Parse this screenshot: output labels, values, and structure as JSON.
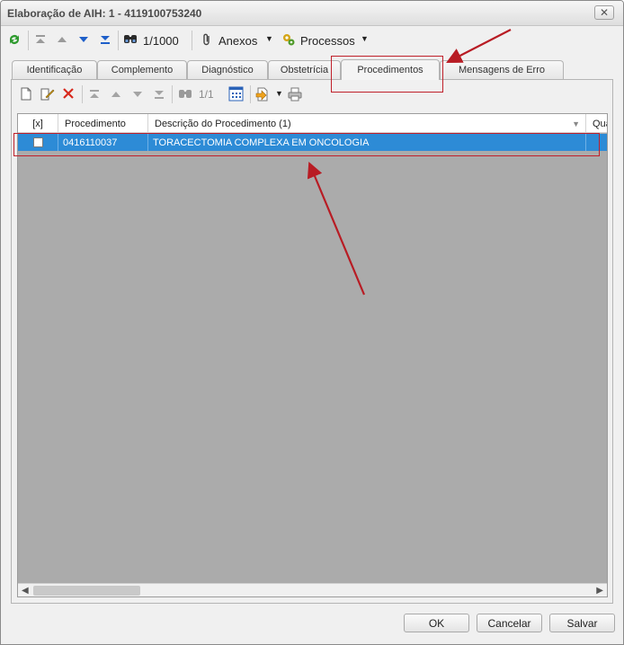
{
  "window": {
    "title": "Elaboração de AIH: 1 - 4119100753240",
    "close_glyph": "✕"
  },
  "toolbar": {
    "record_counter": "1/1000",
    "attachments_label": "Anexos",
    "processes_label": "Processos"
  },
  "tabs": [
    {
      "label": "Identificação"
    },
    {
      "label": "Complemento"
    },
    {
      "label": "Diagnóstico"
    },
    {
      "label": "Obstetrícia"
    },
    {
      "label": "Procedimentos",
      "active": true
    },
    {
      "label": "Mensagens de Erro"
    }
  ],
  "subtoolbar": {
    "record_counter": "1/1"
  },
  "grid": {
    "columns": [
      "[x]",
      "Procedimento",
      "Descrição do Procedimento (1)",
      "Qua"
    ],
    "rows": [
      {
        "checked": false,
        "code": "0416110037",
        "description": "TORACECTOMIA COMPLEXA EM ONCOLOGIA"
      }
    ]
  },
  "footer": {
    "ok_label": "OK",
    "cancel_label": "Cancelar",
    "save_label": "Salvar"
  },
  "colors": {
    "selection": "#2d8bd6",
    "annotation": "#c0202a",
    "grid_background": "#ababab"
  }
}
